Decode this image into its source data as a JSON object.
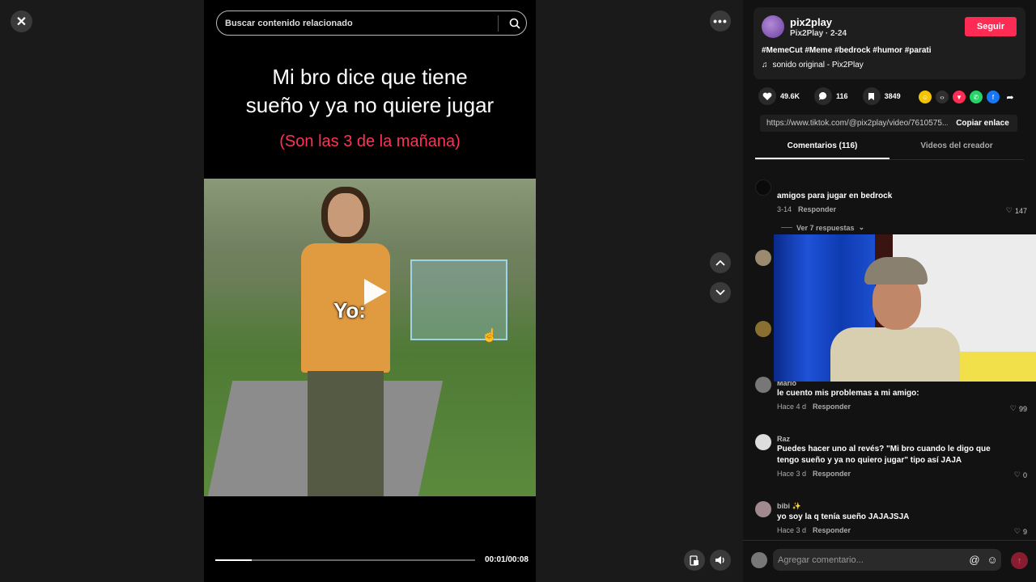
{
  "search": {
    "placeholder": "Buscar contenido relacionado"
  },
  "video": {
    "headline_line1": "Mi bro dice que tiene",
    "headline_line2": "sueño y ya no quiere jugar",
    "subline": "(Son las 3 de la mañana)",
    "overlay_label": "Yo:",
    "time": "00:01/00:08",
    "progress": 0.14
  },
  "author": {
    "username": "pix2play",
    "subtitle": "Pix2Play · 2-24",
    "follow_label": "Seguir",
    "tags": "#MemeCut #Meme #bedrock #humor #parati",
    "sound": "sonido original - Pix2Play"
  },
  "stats": {
    "likes": "49.6K",
    "comments": "116",
    "saves": "3849"
  },
  "share": {
    "url": "https://www.tiktok.com/@pix2play/video/7610575...",
    "copy_label": "Copiar enlace",
    "icons": [
      "twemoji-icon",
      "embed-icon",
      "send-icon",
      "whatsapp-icon",
      "facebook-icon",
      "share-arrow-icon"
    ]
  },
  "tabs": [
    {
      "label": "Comentarios (116)",
      "active": true
    },
    {
      "label": "Videos del creador",
      "active": false
    }
  ],
  "comments": [
    {
      "name": "",
      "text": "amigos para jugar en bedrock",
      "date": "3-14",
      "reply": "Responder",
      "likes": "147"
    },
    {
      "name": "Mario",
      "text": "le cuento mis problemas a mi amigo:",
      "date": "Hace 4 d",
      "reply": "Responder",
      "likes": "99"
    },
    {
      "name": "Raz",
      "text": "Puedes hacer uno al revés? \"Mi bro cuando le digo que tengo sueño y ya no quiero jugar\" tipo así JAJA",
      "date": "Hace 3 d",
      "reply": "Responder",
      "likes": "0"
    },
    {
      "name": "bibi ✨",
      "text": "yo soy la q tenía sueño JAJAJSJA",
      "date": "Hace 3 d",
      "reply": "Responder",
      "likes": "9"
    }
  ],
  "replies_label": "Ver 7 respuestas",
  "comment_box": {
    "placeholder": "Agregar comentario..."
  },
  "colors": {
    "accent": "#fe2c55",
    "subline": "#ff3355"
  }
}
